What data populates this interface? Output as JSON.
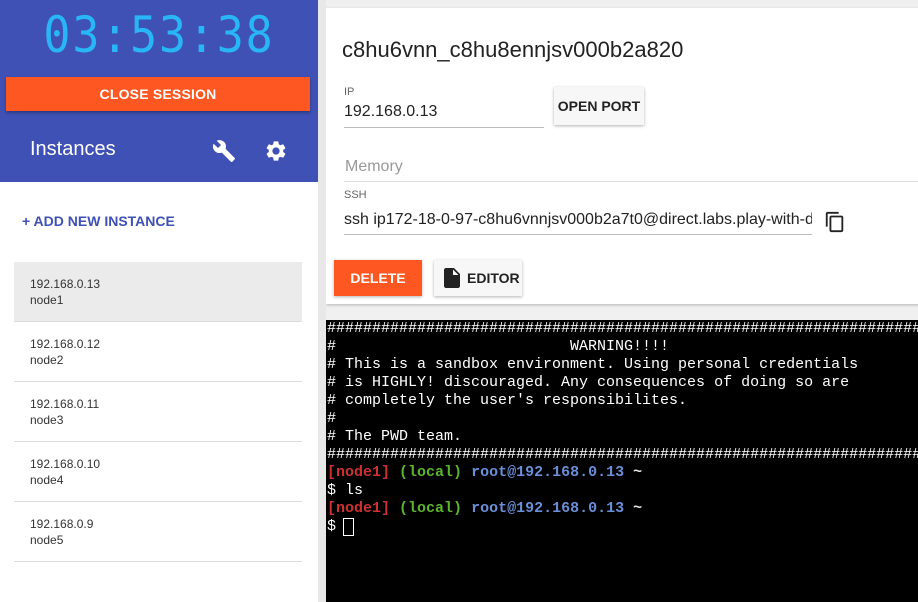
{
  "session": {
    "timer": "03:53:38",
    "close_label": "CLOSE SESSION"
  },
  "sidebar": {
    "title": "Instances",
    "add_label": "+ ADD NEW INSTANCE",
    "icons": [
      "wrench-icon",
      "gear-icon"
    ],
    "instances": [
      {
        "ip": "192.168.0.13",
        "name": "node1",
        "active": true
      },
      {
        "ip": "192.168.0.12",
        "name": "node2",
        "active": false
      },
      {
        "ip": "192.168.0.11",
        "name": "node3",
        "active": false
      },
      {
        "ip": "192.168.0.10",
        "name": "node4",
        "active": false
      },
      {
        "ip": "192.168.0.9",
        "name": "node5",
        "active": false
      }
    ]
  },
  "details": {
    "hostname": "c8hu6vnn_c8hu8ennjsv000b2a820",
    "ip_label": "IP",
    "ip_value": "192.168.0.13",
    "open_port_label": "OPEN PORT",
    "memory_label": "Memory",
    "ssh_label": "SSH",
    "ssh_value": "ssh ip172-18-0-97-c8hu6vnnjsv000b2a7t0@direct.labs.play-with-d",
    "delete_label": "DELETE",
    "editor_label": "EDITOR"
  },
  "terminal": {
    "banner": [
      "######################################################################",
      "#                          WARNING!!!!                               #",
      "# This is a sandbox environment. Using personal credentials          #",
      "# is HIGHLY! discouraged. Any consequences of doing so are           #",
      "# completely the user's responsibilites.                             #",
      "#                                                                    #",
      "# The PWD team.                                                      #",
      "######################################################################"
    ],
    "prompt": {
      "node": "[node1]",
      "local": "(local)",
      "host": "root@192.168.0.13",
      "tilde": "~"
    },
    "command_line": "$ ls",
    "input_prompt": "$"
  },
  "colors": {
    "brand": "#3f51b5",
    "accent": "#ff5722",
    "timer": "#29b6f6"
  }
}
